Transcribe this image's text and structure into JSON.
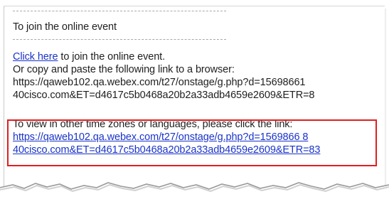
{
  "heading": "To join the online event",
  "join": {
    "link_text": "Click here",
    "after_link": " to join the online event.",
    "copy_instruction": "Or copy and paste the following link to a browser:",
    "url_line1": "https://qaweb102.qa.webex.com/t27/onstage/g.php?d=15698661",
    "url_line2": "40cisco.com&ET=d4617c5b0468a20b2a33adb4659e2609&ETR=8"
  },
  "timezones": {
    "instruction": "To view in other time zones or languages, please click the link:",
    "url_line1": "https://qaweb102.qa.webex.com/t27/onstage/g.php?d=1569866 8",
    "url_line2": "40cisco.com&ET=d4617c5b0468a20b2a33adb4659e2609&ETR=83"
  },
  "colors": {
    "link": "#1a33c9",
    "highlight_border": "#e01e1e",
    "text": "#1f1f1f"
  }
}
